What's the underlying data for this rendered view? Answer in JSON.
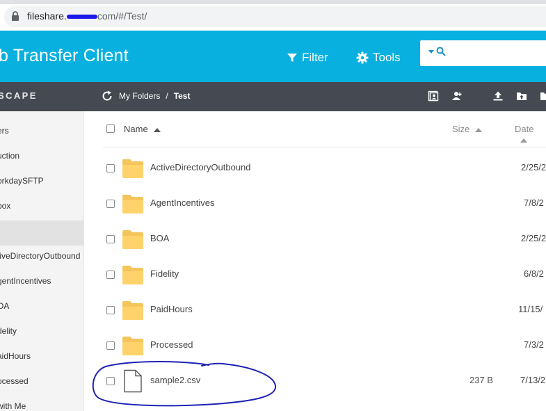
{
  "browser": {
    "url_prefix": "fileshare.",
    "url_suffix": "com/#/Test/"
  },
  "header": {
    "title": "b Transfer Client",
    "filter_label": "Filter",
    "tools_label": "Tools",
    "search_placeholder": "",
    "accent": "#08b0df"
  },
  "toolbar": {
    "brand": "SCAPE",
    "breadcrumb": {
      "root": "My Folders",
      "separator": "/",
      "current": "Test"
    }
  },
  "sidebar": {
    "items": [
      {
        "label": "ers"
      },
      {
        "label": "uction"
      },
      {
        "label": "orkdaySFTP"
      },
      {
        "label": "box"
      },
      {
        "label": ""
      },
      {
        "label": "tiveDirectoryOutbound"
      },
      {
        "label": "gentIncentives"
      },
      {
        "label": "OA"
      },
      {
        "label": "delity"
      },
      {
        "label": "aidHours"
      },
      {
        "label": "ocessed"
      },
      {
        "label": "with Me"
      }
    ]
  },
  "list": {
    "columns": {
      "name": "Name",
      "size": "Size",
      "date": "Date"
    },
    "rows": [
      {
        "name": "ActiveDirectoryOutbound",
        "type": "folder",
        "size": "",
        "date": "2/25/2"
      },
      {
        "name": "AgentIncentives",
        "type": "folder",
        "size": "",
        "date": "7/8/2"
      },
      {
        "name": "BOA",
        "type": "folder",
        "size": "",
        "date": "2/25/2"
      },
      {
        "name": "Fidelity",
        "type": "folder",
        "size": "",
        "date": "6/8/2"
      },
      {
        "name": "PaidHours",
        "type": "folder",
        "size": "",
        "date": "11/15/"
      },
      {
        "name": "Processed",
        "type": "folder",
        "size": "",
        "date": "7/3/2"
      },
      {
        "name": "sample2.csv",
        "type": "file",
        "size": "237 B",
        "date": "7/13/2"
      }
    ]
  }
}
